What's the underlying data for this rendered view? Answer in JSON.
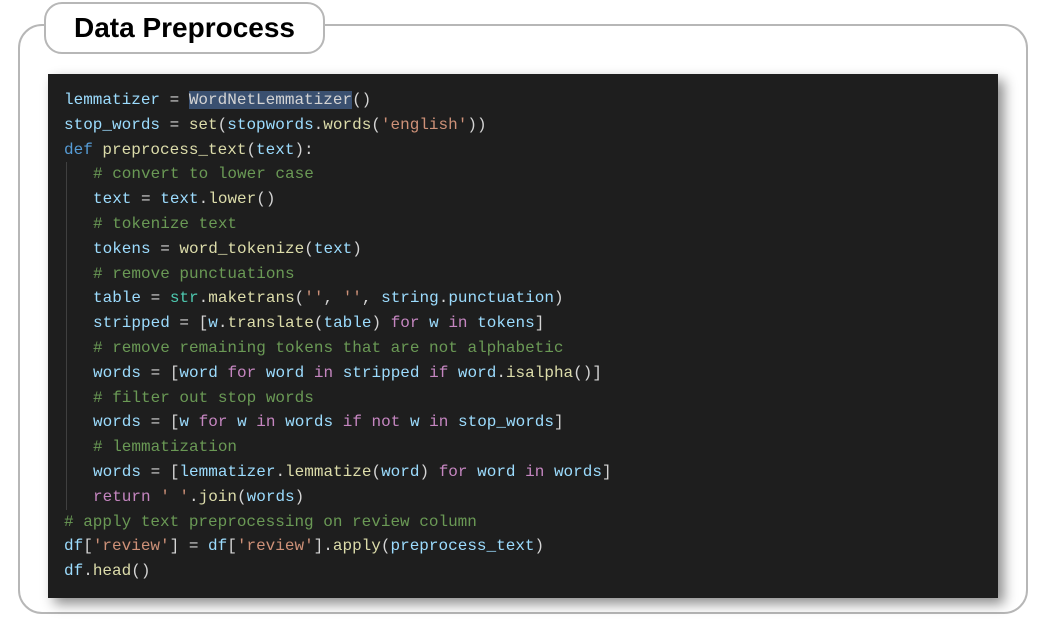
{
  "title": "Data Preprocess",
  "code": {
    "l1": {
      "var1": "lemmatizer",
      "eq": " = ",
      "cls": "WordNetLemmatizer",
      "call": "()"
    },
    "l2": {
      "var1": "stop_words",
      "eq": " = ",
      "fn": "set",
      "open": "(",
      "obj": "stopwords",
      "dot": ".",
      "m": "words",
      "open2": "(",
      "str": "'english'",
      "close2": ")",
      "close": ")"
    },
    "l3": {
      "kw": "def ",
      "fn": "preprocess_text",
      "open": "(",
      "arg": "text",
      "close": "):"
    },
    "l4": {
      "cmt": "# convert to lower case"
    },
    "l5": {
      "v": "text",
      "eq": " = ",
      "obj": "text",
      "dot": ".",
      "m": "lower",
      "call": "()"
    },
    "l6": {
      "cmt": "# tokenize text"
    },
    "l7": {
      "v": "tokens",
      "eq": " = ",
      "fn": "word_tokenize",
      "open": "(",
      "arg": "text",
      "close": ")"
    },
    "l8": {
      "cmt": "# remove punctuations"
    },
    "l9": {
      "v": "table",
      "eq": " = ",
      "cls": "str",
      "dot": ".",
      "m": "maketrans",
      "open": "(",
      "s1": "''",
      "c1": ", ",
      "s2": "''",
      "c2": ", ",
      "obj": "string",
      "dot2": ".",
      "attr": "punctuation",
      "close": ")"
    },
    "l10": {
      "v": "stripped",
      "eq": " = [",
      "obj": "w",
      "dot": ".",
      "m": "translate",
      "open": "(",
      "arg": "table",
      "close": ") ",
      "for": "for",
      "sp": " ",
      "it": "w",
      "sp2": " ",
      "in": "in",
      "sp3": " ",
      "src": "tokens",
      "end": "]"
    },
    "l11": {
      "cmt": "# remove remaining tokens that are not alphabetic"
    },
    "l12": {
      "v": "words",
      "eq": " = [",
      "it": "word",
      "sp": " ",
      "for": "for",
      "sp2": " ",
      "it2": "word",
      "sp3": " ",
      "in": "in",
      "sp4": " ",
      "src": "stripped",
      "sp5": " ",
      "if": "if",
      "sp6": " ",
      "obj": "word",
      "dot": ".",
      "m": "isalpha",
      "call": "()",
      "end": "]"
    },
    "l13": {
      "cmt": "# filter out stop words"
    },
    "l14": {
      "v": "words",
      "eq": " = [",
      "it": "w",
      "sp": " ",
      "for": "for",
      "sp2": " ",
      "it2": "w",
      "sp3": " ",
      "in": "in",
      "sp4": " ",
      "src": "words",
      "sp5": " ",
      "if": "if",
      "sp6": " ",
      "not": "not",
      "sp7": " ",
      "it3": "w",
      "sp8": " ",
      "in2": "in",
      "sp9": " ",
      "src2": "stop_words",
      "end": "]"
    },
    "l15": {
      "cmt": "# lemmatization"
    },
    "l16": {
      "v": "words",
      "eq": " = [",
      "obj": "lemmatizer",
      "dot": ".",
      "m": "lemmatize",
      "open": "(",
      "arg": "word",
      "close": ") ",
      "for": "for",
      "sp": " ",
      "it": "word",
      "sp2": " ",
      "in": "in",
      "sp3": " ",
      "src": "words",
      "end": "]"
    },
    "l17": {
      "ret": "return",
      "str": " ' '",
      "dot": ".",
      "m": "join",
      "open": "(",
      "arg": "words",
      "close": ")"
    },
    "l18": {
      "cmt": "# apply text preprocessing on review column"
    },
    "l19": {
      "v": "df",
      "open": "[",
      "s": "'review'",
      "close": "]",
      "eq": " = ",
      "v2": "df",
      "open2": "[",
      "s2": "'review'",
      "close2": "].",
      "m": "apply",
      "open3": "(",
      "arg": "preprocess_text",
      "close3": ")"
    },
    "l20": {
      "v": "df",
      "dot": ".",
      "m": "head",
      "call": "()"
    }
  }
}
